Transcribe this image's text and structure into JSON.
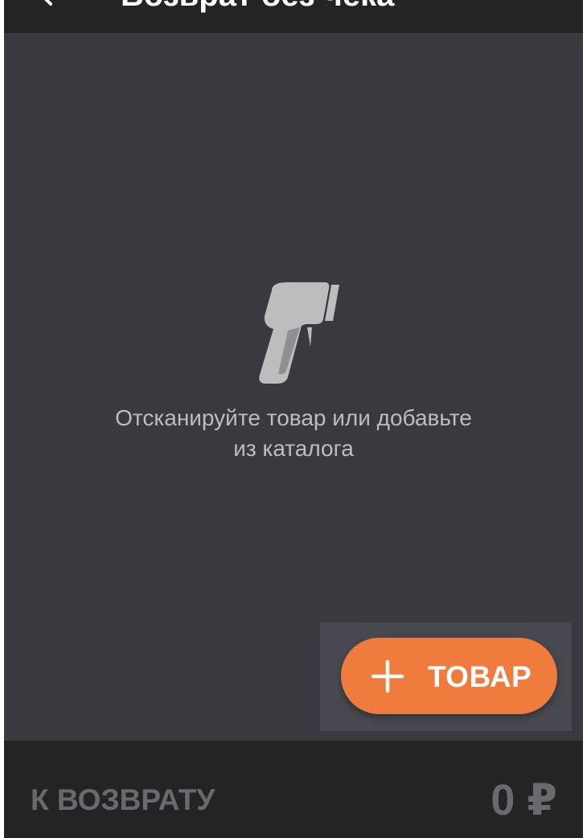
{
  "header": {
    "title": "Возврат без чека",
    "back_icon": "arrow-left-icon"
  },
  "empty_state": {
    "icon": "barcode-scanner-icon",
    "message_line1": "Отсканируйте товар или добавьте",
    "message_line2": "из каталога"
  },
  "fab": {
    "icon": "plus-icon",
    "label": "ТОВАР"
  },
  "footer": {
    "refund_label": "К ВОЗВРАТУ",
    "refund_amount": "0 ₽"
  },
  "colors": {
    "background": "#393940",
    "bars": "#242424",
    "accent": "#ef7c3d",
    "muted_text": "#69696e",
    "message_text": "#bdbdc0",
    "icon": "#bdbdbd"
  }
}
